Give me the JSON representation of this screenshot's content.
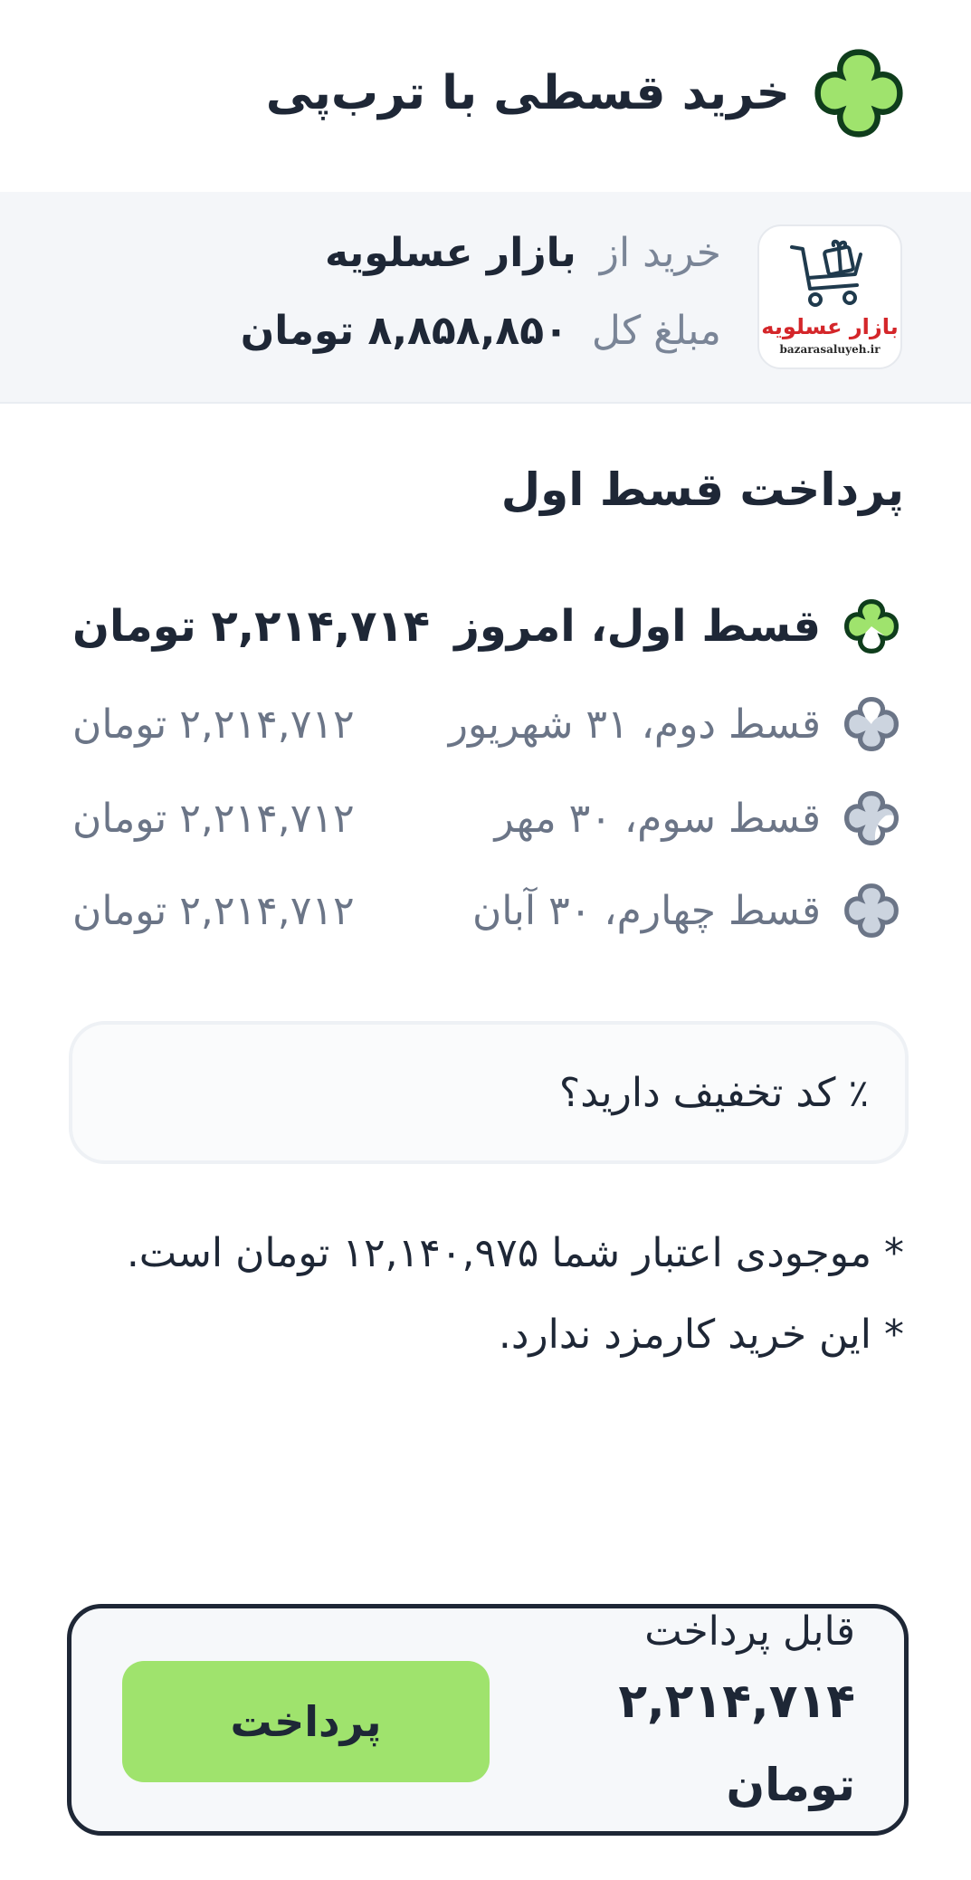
{
  "header": {
    "title": "خرید قسطی با ترب‌پی"
  },
  "merchant": {
    "logo_name": "بازار عسلویه",
    "logo_site": "bazarasaluyeh.ir",
    "from_label": "خرید از",
    "from_value": "بازار عسلویه",
    "total_label": "مبلغ کل",
    "total_value": "۸,۸۵۸,۸۵۰ تومان"
  },
  "section_title": "پرداخت قسط اول",
  "installments": [
    {
      "label": "قسط اول، امروز",
      "amount": "۲,۲۱۴,۷۱۴ تومان",
      "active": true
    },
    {
      "label": "قسط دوم، ۳۱ شهریور",
      "amount": "۲,۲۱۴,۷۱۲ تومان",
      "active": false
    },
    {
      "label": "قسط سوم، ۳۰ مهر",
      "amount": "۲,۲۱۴,۷۱۲ تومان",
      "active": false
    },
    {
      "label": "قسط چهارم، ۳۰ آبان",
      "amount": "۲,۲۱۴,۷۱۲ تومان",
      "active": false
    }
  ],
  "discount": {
    "icon": "٪",
    "label": "کد تخفیف دارید؟"
  },
  "notes": [
    "* موجودی اعتبار شما ۱۲,۱۴۰,۹۷۵ تومان است.",
    "* این خرید کارمزد ندارد."
  ],
  "payment": {
    "label": "قابل پرداخت",
    "amount": "۲,۲۱۴,۷۱۴",
    "currency": "تومان",
    "button": "پرداخت"
  },
  "colors": {
    "brand_green": "#9fe36d",
    "dark_text": "#1e2736",
    "muted_text": "#6b7587",
    "inactive_icon": "#ccd4df"
  }
}
